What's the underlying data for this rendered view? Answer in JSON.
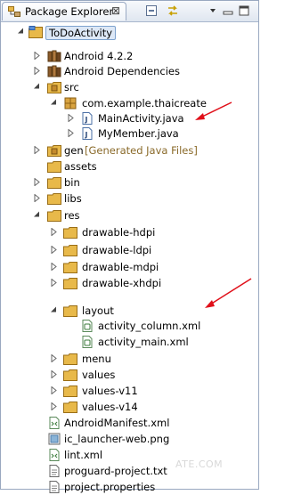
{
  "view": {
    "tab_title": "Package Explorer",
    "close_glyph": "⊠"
  },
  "tree": {
    "project": "ToDoActivity",
    "android_version": "Android 4.2.2",
    "android_deps": "Android Dependencies",
    "src": "src",
    "package": "com.example.thaicreate",
    "main_activity": "MainActivity.java",
    "my_member": "MyMember.java",
    "gen": "gen",
    "gen_note": "[Generated Java Files]",
    "assets": "assets",
    "bin": "bin",
    "libs": "libs",
    "res": "res",
    "drawable_hdpi": "drawable-hdpi",
    "drawable_ldpi": "drawable-ldpi",
    "drawable_mdpi": "drawable-mdpi",
    "drawable_xhdpi": "drawable-xhdpi",
    "layout": "layout",
    "activity_column": "activity_column.xml",
    "activity_main": "activity_main.xml",
    "menu": "menu",
    "values": "values",
    "values_v11": "values-v11",
    "values_v14": "values-v14",
    "manifest": "AndroidManifest.xml",
    "ic_launcher": "ic_launcher-web.png",
    "lint": "lint.xml",
    "proguard": "proguard-project.txt",
    "project_properties": "project.properties"
  },
  "watermark": "ATE.COM",
  "colors": {
    "arrow": "#e0101a",
    "folder": "#e8b94a",
    "selection": "#dde8f6"
  }
}
